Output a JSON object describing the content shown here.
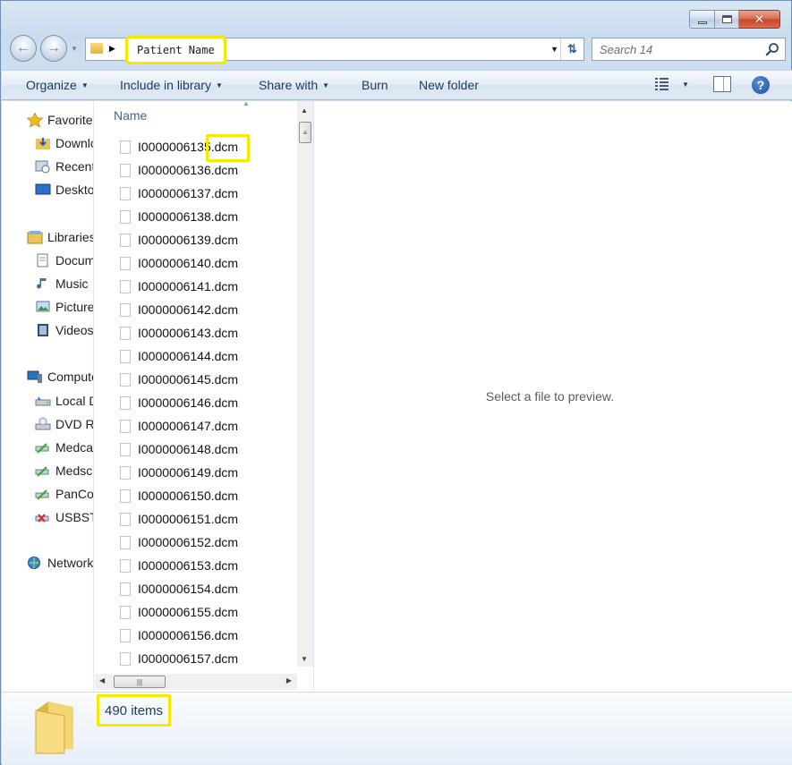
{
  "window": {
    "controls": {
      "minimize": "minimize",
      "maximize": "maximize",
      "close": "✕"
    }
  },
  "navigation": {
    "address_crumb": "Patient Name",
    "search_placeholder": "Search 14"
  },
  "toolbar": {
    "organize": "Organize",
    "include_in_library": "Include in library",
    "share_with": "Share with",
    "burn": "Burn",
    "new_folder": "New folder"
  },
  "nav_pane": {
    "favorites": {
      "label": "Favorites",
      "items": [
        "Downloads",
        "Recent Places",
        "Desktop"
      ]
    },
    "libraries": {
      "label": "Libraries",
      "items": [
        "Documents",
        "Music",
        "Pictures",
        "Videos"
      ]
    },
    "computer": {
      "label": "Computer",
      "items": [
        "Local Disk",
        "DVD RW Drive",
        "Medcare",
        "Medscan",
        "PanCo",
        "USBSTOR"
      ]
    },
    "network": {
      "label": "Network"
    }
  },
  "file_list": {
    "column_header": "Name",
    "files": [
      "I0000006135.dcm",
      "I0000006136.dcm",
      "I0000006137.dcm",
      "I0000006138.dcm",
      "I0000006139.dcm",
      "I0000006140.dcm",
      "I0000006141.dcm",
      "I0000006142.dcm",
      "I0000006143.dcm",
      "I0000006144.dcm",
      "I0000006145.dcm",
      "I0000006146.dcm",
      "I0000006147.dcm",
      "I0000006148.dcm",
      "I0000006149.dcm",
      "I0000006150.dcm",
      "I0000006151.dcm",
      "I0000006152.dcm",
      "I0000006153.dcm",
      "I0000006154.dcm",
      "I0000006155.dcm",
      "I0000006156.dcm",
      "I0000006157.dcm"
    ]
  },
  "preview": {
    "message": "Select a file to preview."
  },
  "details": {
    "item_count": "490 items"
  },
  "colors": {
    "highlight": "#f4ea00",
    "command_text": "#1e395b"
  }
}
